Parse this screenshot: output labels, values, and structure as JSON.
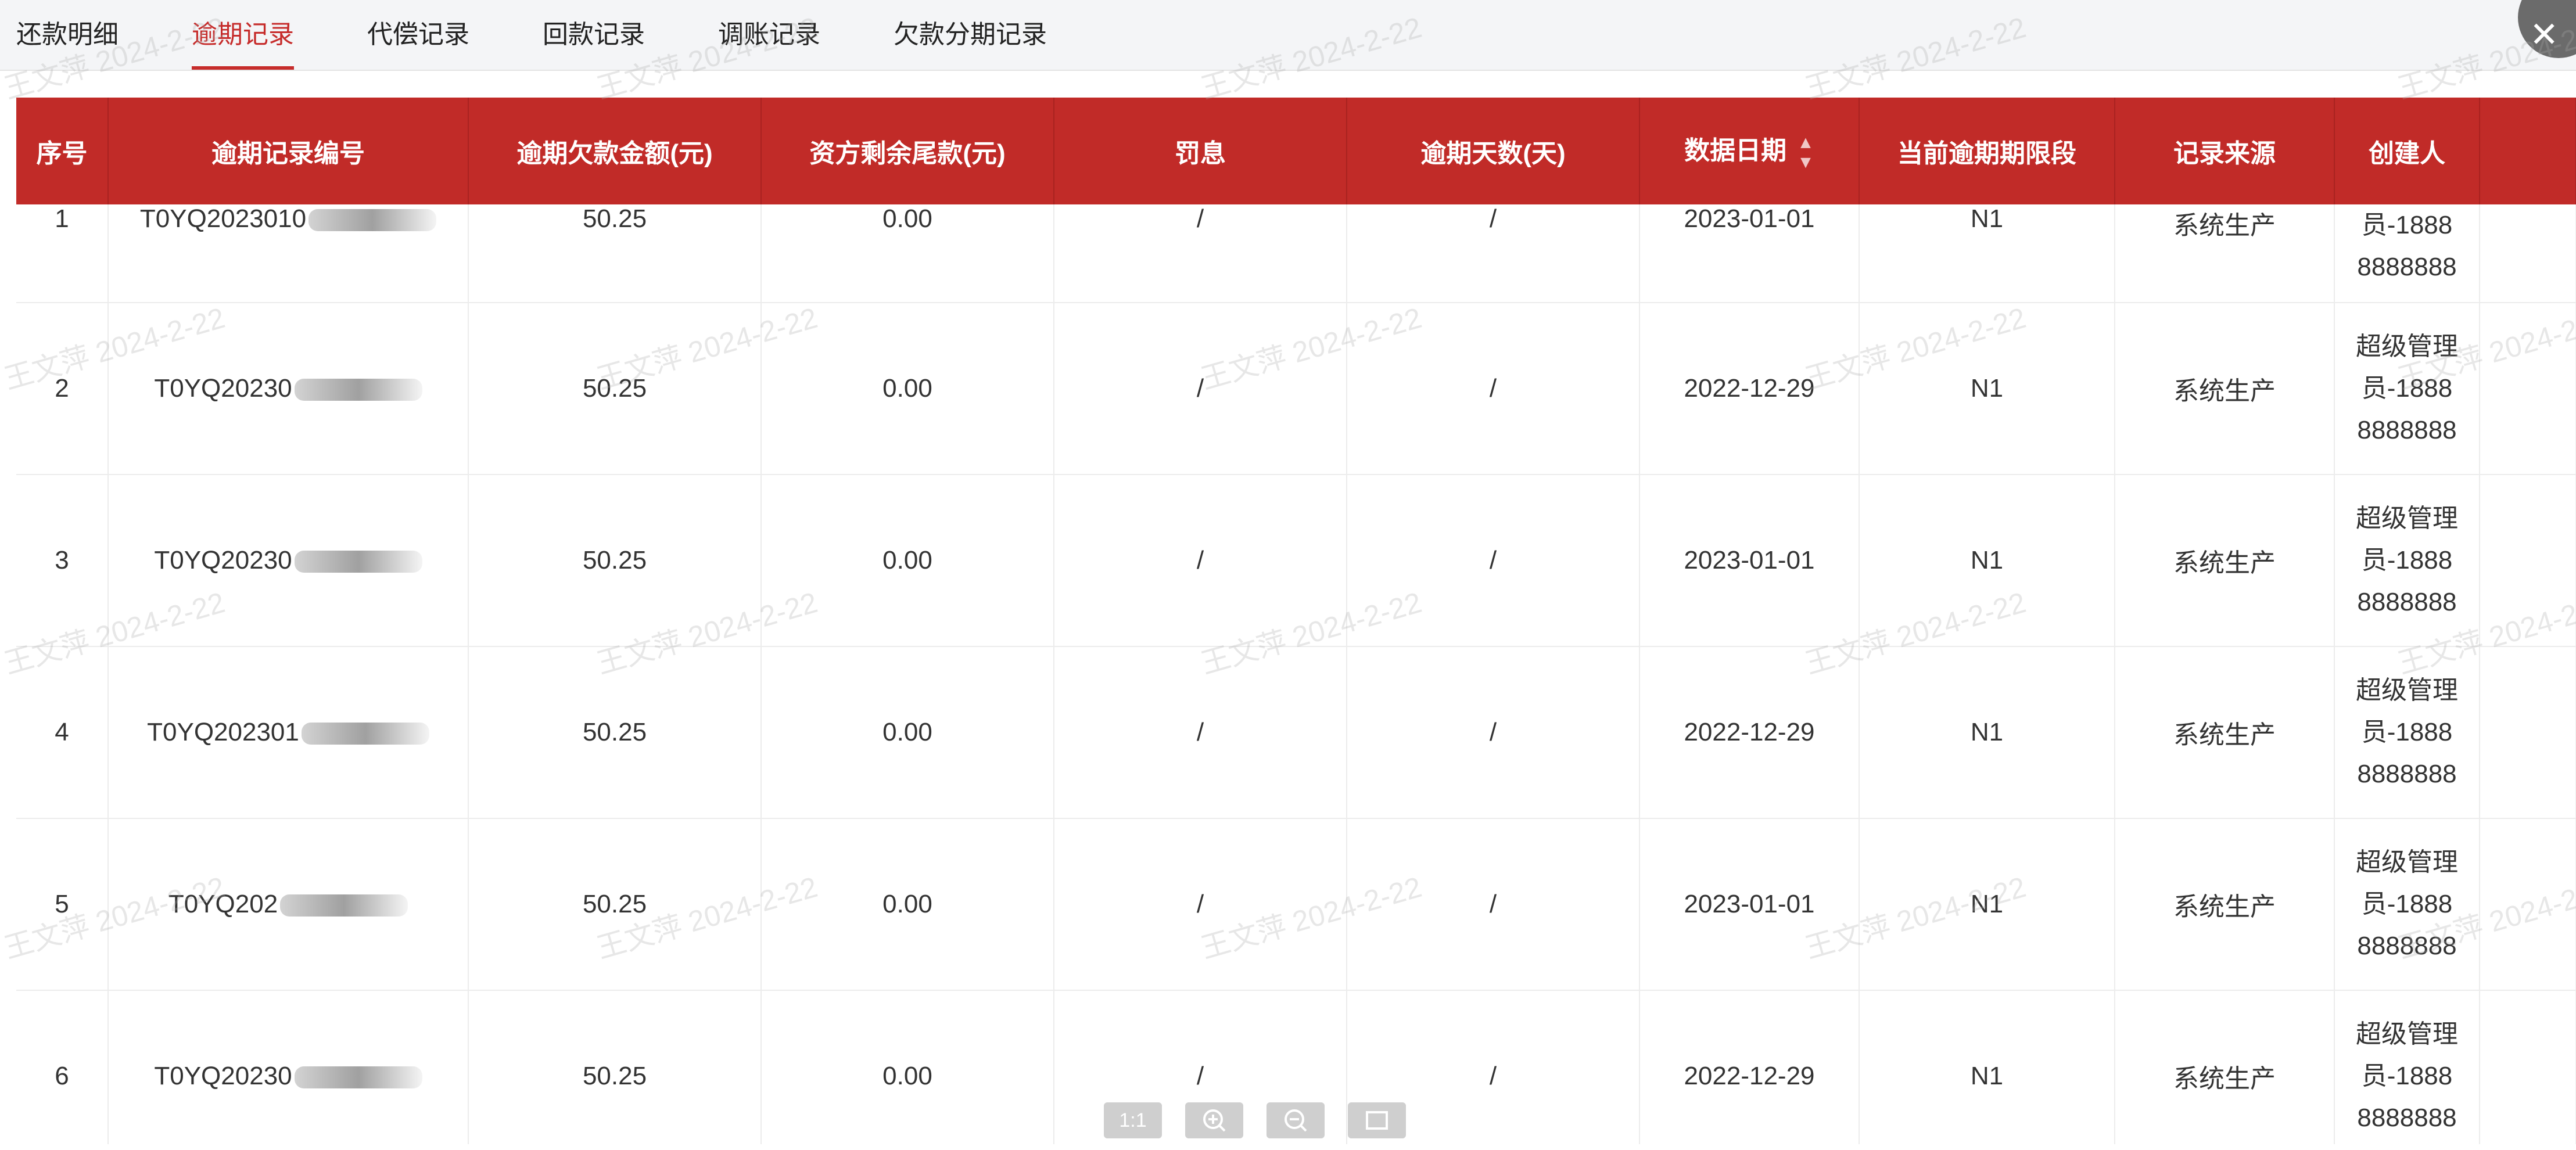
{
  "tabs": [
    {
      "label": "还款明细",
      "active": false
    },
    {
      "label": "逾期记录",
      "active": true
    },
    {
      "label": "代偿记录",
      "active": false
    },
    {
      "label": "回款记录",
      "active": false
    },
    {
      "label": "调账记录",
      "active": false
    },
    {
      "label": "欠款分期记录",
      "active": false
    }
  ],
  "table": {
    "columns": [
      "序号",
      "逾期记录编号",
      "逾期欠款金额(元)",
      "资方剩余尾款(元)",
      "罚息",
      "逾期天数(天)",
      "数据日期",
      "当前逾期期限段",
      "记录来源",
      "创建人"
    ],
    "rows": [
      {
        "index": "1",
        "id": "T0YQ2023010",
        "amount": "50.25",
        "balance": "0.00",
        "penalty": "/",
        "days": "/",
        "date": "2023-01-01",
        "stage": "N1",
        "source": "系统生产",
        "creator": [
          "员-1888",
          "8888888"
        ]
      },
      {
        "index": "2",
        "id": "T0YQ20230",
        "amount": "50.25",
        "balance": "0.00",
        "penalty": "/",
        "days": "/",
        "date": "2022-12-29",
        "stage": "N1",
        "source": "系统生产",
        "creator": [
          "超级管理",
          "员-1888",
          "8888888"
        ]
      },
      {
        "index": "3",
        "id": "T0YQ20230",
        "amount": "50.25",
        "balance": "0.00",
        "penalty": "/",
        "days": "/",
        "date": "2023-01-01",
        "stage": "N1",
        "source": "系统生产",
        "creator": [
          "超级管理",
          "员-1888",
          "8888888"
        ]
      },
      {
        "index": "4",
        "id": "T0YQ202301",
        "amount": "50.25",
        "balance": "0.00",
        "penalty": "/",
        "days": "/",
        "date": "2022-12-29",
        "stage": "N1",
        "source": "系统生产",
        "creator": [
          "超级管理",
          "员-1888",
          "8888888"
        ]
      },
      {
        "index": "5",
        "id": "T0YQ202",
        "amount": "50.25",
        "balance": "0.00",
        "penalty": "/",
        "days": "/",
        "date": "2023-01-01",
        "stage": "N1",
        "source": "系统生产",
        "creator": [
          "超级管理",
          "员-1888",
          "8888888"
        ]
      },
      {
        "index": "6",
        "id": "T0YQ20230",
        "amount": "50.25",
        "balance": "0.00",
        "penalty": "/",
        "days": "/",
        "date": "2022-12-29",
        "stage": "N1",
        "source": "系统生产",
        "creator": [
          "超级管理",
          "员-1888",
          "8888888"
        ]
      }
    ]
  },
  "watermark": "王文萍 2024-2-22",
  "toolbar": {
    "one_to_one": "1:1",
    "zoom_in_icon": "zoom-in-icon",
    "zoom_out_icon": "zoom-out-icon",
    "fit_icon": "fit-screen-icon"
  },
  "colors": {
    "header_bg": "#c12b28",
    "accent": "#c62c2b"
  }
}
